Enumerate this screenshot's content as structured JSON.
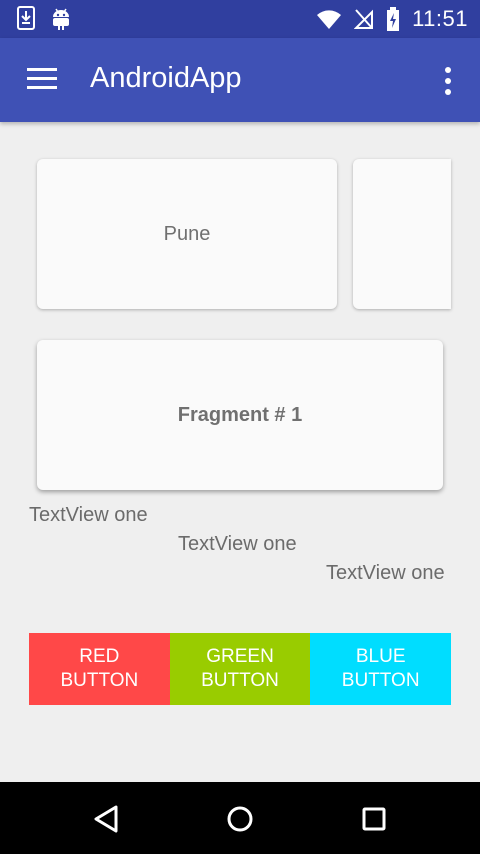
{
  "status_bar": {
    "time": "11:51",
    "left_icons": [
      "download-icon",
      "android-icon"
    ],
    "right_icons": [
      "wifi-icon",
      "no-signal-icon",
      "battery-charging-icon"
    ]
  },
  "app_bar": {
    "title": "AndroidApp",
    "menu_icon": "hamburger-menu-icon",
    "overflow_icon": "more-vert-icon",
    "color": "#3f51b5",
    "status_color": "#303f9f"
  },
  "cards": {
    "city_label": "Pune",
    "fragment_label": "Fragment # 1"
  },
  "textviews": [
    "TextView one",
    "TextView one",
    "TextView one"
  ],
  "buttons": [
    {
      "label": "RED\nBUTTON",
      "color": "#ff4848"
    },
    {
      "label": "GREEN\nBUTTON",
      "color": "#99cc00"
    },
    {
      "label": "BLUE\nBUTTON",
      "color": "#00ddff"
    }
  ],
  "nav_bar": {
    "icons": [
      "back-icon",
      "home-icon",
      "recents-icon"
    ]
  }
}
